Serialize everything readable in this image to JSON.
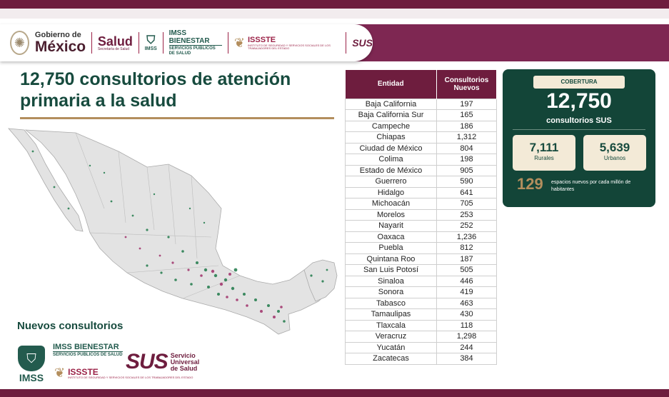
{
  "header": {
    "gobierno_small": "Gobierno de",
    "gobierno_big": "México",
    "salud_big": "Salud",
    "salud_small": "Secretaría de Salud",
    "imss_label": "IMSS",
    "imss_bienestar_big": "IMSS BIENESTAR",
    "imss_bienestar_small": "SERVICIOS PÚBLICOS DE SALUD",
    "issste_big": "ISSSTE",
    "issste_small": "INSTITUTO DE SEGURIDAD Y SERVICIOS SOCIALES DE LOS TRABAJADORES DEL ESTADO",
    "sus_mini": "SUS"
  },
  "title": "12,750 consultorios de atención primaria a la salud",
  "colors": {
    "guinda": "#6e1d3e",
    "green_dark": "#134538",
    "gold": "#b38e5d",
    "map_green": "#1f7a4a",
    "map_pink": "#a0306a"
  },
  "table": {
    "headers": [
      "Entidad",
      "Consultorios Nuevos"
    ],
    "rows": [
      [
        "Baja California",
        "197"
      ],
      [
        "Baja California Sur",
        "165"
      ],
      [
        "Campeche",
        "186"
      ],
      [
        "Chiapas",
        "1,312"
      ],
      [
        "Ciudad de México",
        "804"
      ],
      [
        "Colima",
        "198"
      ],
      [
        "Estado de México",
        "905"
      ],
      [
        "Guerrero",
        "590"
      ],
      [
        "Hidalgo",
        "641"
      ],
      [
        "Michoacán",
        "705"
      ],
      [
        "Morelos",
        "253"
      ],
      [
        "Nayarit",
        "252"
      ],
      [
        "Oaxaca",
        "1,236"
      ],
      [
        "Puebla",
        "812"
      ],
      [
        "Quintana Roo",
        "187"
      ],
      [
        "San Luis Potosí",
        "505"
      ],
      [
        "Sinaloa",
        "446"
      ],
      [
        "Sonora",
        "419"
      ],
      [
        "Tabasco",
        "463"
      ],
      [
        "Tamaulipas",
        "430"
      ],
      [
        "Tlaxcala",
        "118"
      ],
      [
        "Veracruz",
        "1,298"
      ],
      [
        "Yucatán",
        "244"
      ],
      [
        "Zacatecas",
        "384"
      ]
    ]
  },
  "coverage": {
    "tag": "COBERTURA",
    "total": "12,750",
    "total_label": "consultorios SUS",
    "rural_value": "7,111",
    "rural_label": "Rurales",
    "urban_value": "5,639",
    "urban_label": "Urbanos",
    "density_value": "129",
    "density_label": "espacios nuevos por cada millón de habitantes"
  },
  "bottom": {
    "heading": "Nuevos consultorios",
    "imss_label": "IMSS",
    "imss_bienestar_big": "IMSS BIENESTAR",
    "imss_bienestar_small": "SERVICIOS PÚBLICOS DE SALUD",
    "issste_big": "ISSSTE",
    "issste_small": "INSTITUTO DE SEGURIDAD Y SERVICIOS SOCIALES DE LOS TRABAJADORES DEL ESTADO",
    "sus_word": "SUS",
    "sus_line1": "Servicio",
    "sus_line2": "Universal",
    "sus_line3": "de Salud"
  },
  "icons": {
    "seal": "national-seal-icon",
    "imss": "imss-eagle-icon",
    "issste": "issste-emblem-icon"
  }
}
